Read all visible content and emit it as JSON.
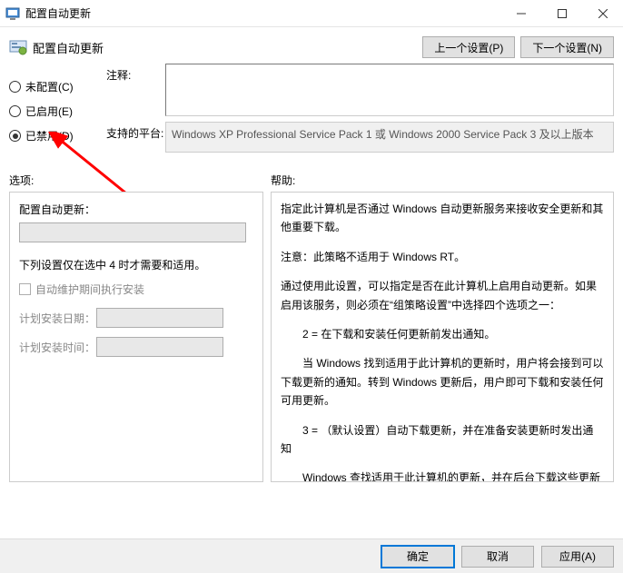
{
  "window": {
    "title": "配置自动更新"
  },
  "header": {
    "title": "配置自动更新",
    "prev_label": "上一个设置(P)",
    "next_label": "下一个设置(N)"
  },
  "radios": {
    "not_configured": "未配置(C)",
    "enabled": "已启用(E)",
    "disabled": "已禁用(D)",
    "selected": "disabled"
  },
  "fields": {
    "comment_label": "注释:",
    "comment_value": "",
    "platform_label": "支持的平台:",
    "platform_value": "Windows XP Professional Service Pack 1 或 Windows 2000 Service Pack 3 及以上版本"
  },
  "labels": {
    "options": "选项:",
    "help": "帮助:"
  },
  "options": {
    "title": "配置自动更新：",
    "note": "下列设置仅在选中 4 时才需要和适用。",
    "checkbox": "自动维护期间执行安装",
    "install_day_label": "计划安装日期：",
    "install_time_label": "计划安装时间："
  },
  "help": {
    "p1": "指定此计算机是否通过 Windows 自动更新服务来接收安全更新和其他重要下载。",
    "p2": "注意：此策略不适用于 Windows RT。",
    "p3": "通过使用此设置，可以指定是否在此计算机上启用自动更新。如果启用该服务，则必须在“组策略设置”中选择四个选项之一：",
    "p4": "2 = 在下载和安装任何更新前发出通知。",
    "p5": "当 Windows 找到适用于此计算机的更新时，用户将会接到可以下载更新的通知。转到 Windows 更新后，用户即可下载和安装任何可用更新。",
    "p6": "3 = （默认设置）自动下载更新，并在准备安装更新时发出通知",
    "p7": "Windows 查找适用于此计算机的更新，并在后台下载这些更新（在此过程中，用户不会收到通知或被打断工作）。完成下载后，用户将收到可以安装更新的通知。转到 Windows 更新后，用户即可安装更新。"
  },
  "footer": {
    "ok": "确定",
    "cancel": "取消",
    "apply": "应用(A)"
  }
}
